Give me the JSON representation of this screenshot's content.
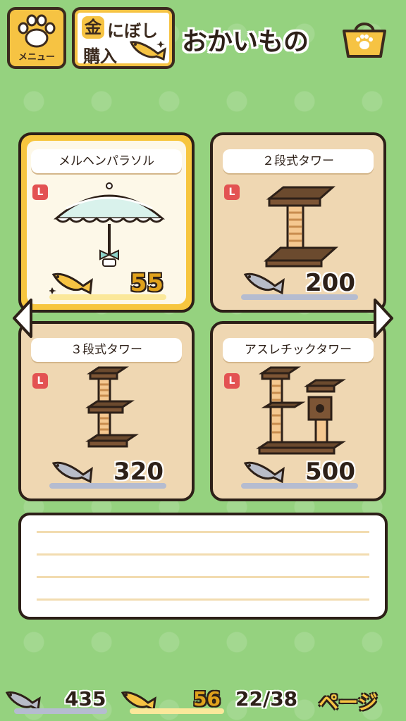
{
  "header": {
    "menu_label": "メニュー",
    "gold_button_prefix": "金",
    "gold_button_line1": "にぼし",
    "gold_button_line2": "購入",
    "title": "おかいもの",
    "icons": {
      "menu": "paw-icon",
      "gold": "gold-fish-icon",
      "shop": "shopping-bag-icon"
    }
  },
  "items": [
    {
      "name": "メルヘンパラソル",
      "size_badge": "L",
      "price": "55",
      "currency": "gold-niboshi",
      "selected": true
    },
    {
      "name": "２段式タワー",
      "size_badge": "L",
      "price": "200",
      "currency": "niboshi",
      "selected": false
    },
    {
      "name": "３段式タワー",
      "size_badge": "L",
      "price": "320",
      "currency": "niboshi",
      "selected": false
    },
    {
      "name": "アスレチックタワー",
      "size_badge": "L",
      "price": "500",
      "currency": "niboshi",
      "selected": false
    }
  ],
  "description": "",
  "footer": {
    "silver_count": "435",
    "gold_count": "56",
    "page": "22/38",
    "page_label": "ページ"
  },
  "colors": {
    "background": "#95d27f",
    "card": "#efd7b2",
    "selected_card": "#f7c63f",
    "outline": "#2d2018",
    "size_badge": "#e35252"
  }
}
